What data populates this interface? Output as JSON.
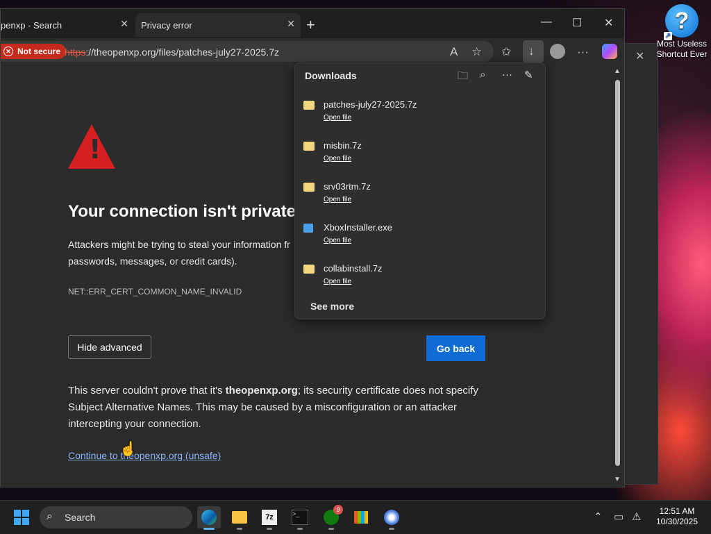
{
  "desktop": {
    "icon_label": "Most Useless Shortcut Ever"
  },
  "browser": {
    "tabs": [
      {
        "label": "penxp - Search"
      },
      {
        "label": "Privacy error"
      }
    ],
    "address_bar": {
      "security_label": "Not secure",
      "url_scheme": "https",
      "url_rest": "://theopenxp.org/files/patches-july27-2025.7z"
    }
  },
  "error_page": {
    "heading": "Your connection isn't private",
    "description": "Attackers might be trying to steal your information from theopenxp.org (for example, passwords, messages, or credit cards).",
    "description_line2": "passwords, messages, or credit cards).",
    "description_line1": "Attackers might be trying to steal your information fr",
    "error_code": "NET::ERR_CERT_COMMON_NAME_INVALID",
    "hide_advanced": "Hide advanced",
    "go_back": "Go back",
    "detail_pre": "This server couldn't prove that it's ",
    "detail_domain": "theopenxp.org",
    "detail_post": "; its security certificate does not specify Subject Alternative Names. This may be caused by a misconfiguration or an attacker intercepting your connection.",
    "continue_link": "Continue to theopenxp.org (unsafe)"
  },
  "downloads": {
    "title": "Downloads",
    "items": [
      {
        "name": "patches-july27-2025.7z",
        "action": "Open file",
        "icon": "archive-icon"
      },
      {
        "name": "misbin.7z",
        "action": "Open file",
        "icon": "archive-icon"
      },
      {
        "name": "srv03rtm.7z",
        "action": "Open file",
        "icon": "archive-icon"
      },
      {
        "name": "XboxInstaller.exe",
        "action": "Open file",
        "icon": "exe-icon"
      },
      {
        "name": "collabinstall.7z",
        "action": "Open file",
        "icon": "archive-icon"
      }
    ],
    "see_more": "See more"
  },
  "taskbar": {
    "search_label": "Search",
    "xbox_badge": "9",
    "clock_time": "12:51 AM",
    "clock_date": "10/30/2025"
  },
  "colors": {
    "accent": "#0f6cd4",
    "danger": "#c42b1c",
    "link": "#8ab4f8"
  }
}
